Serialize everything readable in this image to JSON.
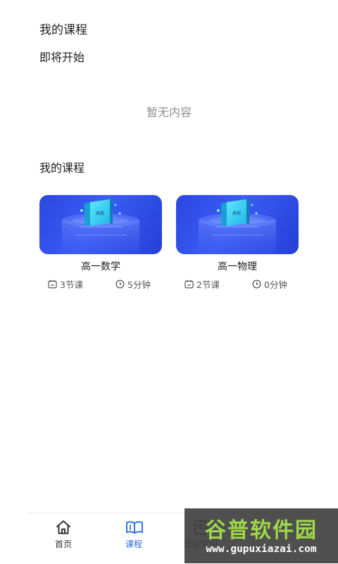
{
  "header": {
    "title": "我的课程"
  },
  "upcoming": {
    "heading": "即将开始",
    "empty_text": "暂无内容"
  },
  "mine": {
    "heading": "我的课程",
    "courses": [
      {
        "name": "高一数学",
        "lessons": "3节课",
        "duration": "5分钟",
        "cover_badge": "高数"
      },
      {
        "name": "高一物理",
        "lessons": "2节课",
        "duration": "0分钟",
        "cover_badge": "高物"
      }
    ]
  },
  "tabbar": {
    "items": [
      {
        "label": "首页",
        "icon": "home-icon",
        "active": false
      },
      {
        "label": "课程",
        "icon": "book-open-icon",
        "active": true
      },
      {
        "label": "作业空间",
        "icon": "workspace-icon",
        "active": false
      }
    ]
  },
  "colors": {
    "accent": "#2c6bde",
    "card_blue": "#2b47e0",
    "muted_text": "#8e8e8e"
  },
  "watermark": {
    "title": "谷普软件园",
    "url": "www.gupuxiazai.com"
  }
}
